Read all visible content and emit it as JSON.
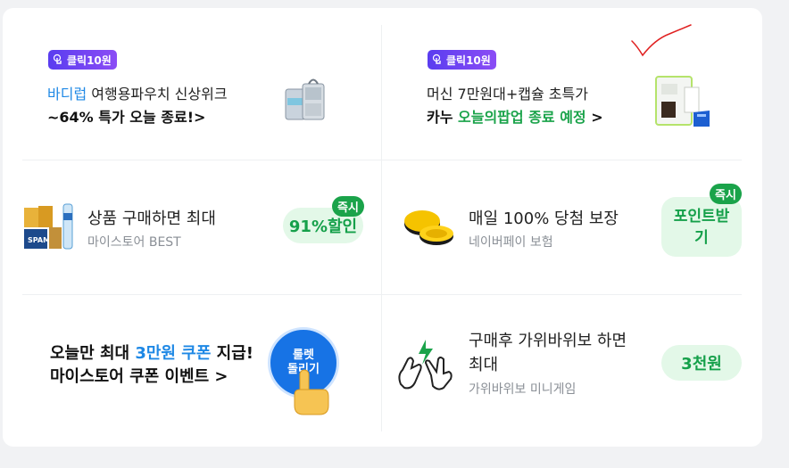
{
  "cards": {
    "bodyrub": {
      "badge": "클릭10원",
      "brand": "바디럽",
      "line1_rest": " 여행용파우치 신상위크",
      "line2": "~64% 특가 오늘 종료!>"
    },
    "kanu": {
      "badge": "클릭10원",
      "line1": "머신 7만원대+캡슐 초특가",
      "line2_start": "카누 ",
      "line2_highlight": "오늘의팝업 종료 예정",
      "line2_end": " >"
    },
    "mystore_best": {
      "title": "상품 구매하면 최대",
      "subtitle": "마이스토어 BEST",
      "pill": "91%할인",
      "tag": "즉시"
    },
    "npay": {
      "title": "매일 100% 당첨 보장",
      "subtitle": "네이버페이 보험",
      "pill_line1": "포인트받",
      "pill_line2": "기",
      "tag": "즉시"
    },
    "coupon": {
      "line1_start": "오늘만 최대 ",
      "line1_highlight": "3만원 쿠폰",
      "line1_end": " 지급!",
      "line2": "마이스토어 쿠폰 이벤트 >",
      "roulette_line1": "룰렛",
      "roulette_line2": "돌리기"
    },
    "rps": {
      "title_line1": "구매후 가위바위보 하면",
      "title_line2": "최대",
      "subtitle": "가위바위보 미니게임",
      "pill": "3천원"
    }
  },
  "icons": {
    "badge_icon": "hand-tap-icon",
    "pouch": "travel-pouch-image",
    "coffee": "capsule-coffee-machine-image",
    "products": "grocery-products-image",
    "coins": "gold-coins-icon",
    "roulette": "roulette-button-image",
    "hand": "pointing-hand-icon",
    "rps": "rock-paper-scissors-icon",
    "checkmark": "red-checkmark-annotation"
  },
  "colors": {
    "badge": "#6a44f2",
    "highlight_blue": "#1e88e5",
    "highlight_green": "#1aa34a",
    "pill_bg": "#e3f8e8",
    "pill_text": "#15a04a",
    "roulette_blue": "#1773e5"
  }
}
